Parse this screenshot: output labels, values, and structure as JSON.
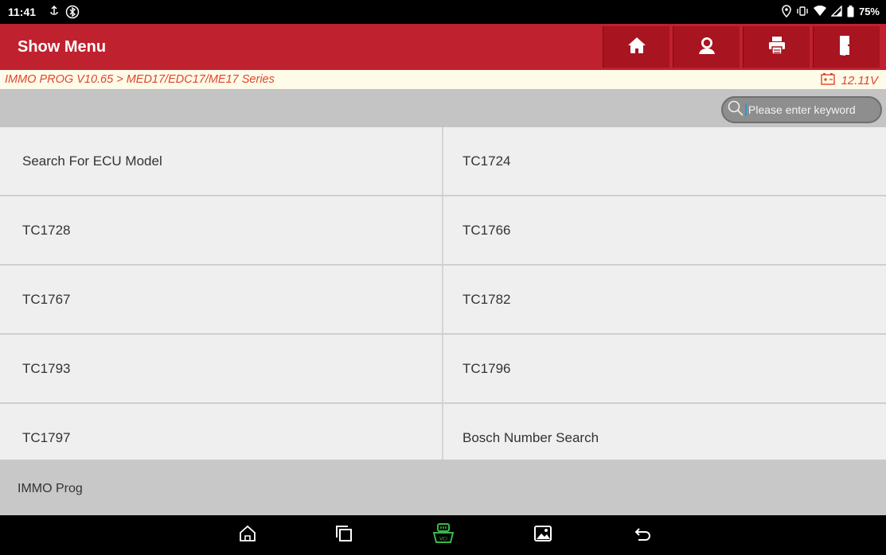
{
  "status": {
    "time": "11:41",
    "battery": "75%",
    "icons": [
      "usb-debug-icon",
      "bluetooth-status-icon",
      "location-icon",
      "vibrate-icon",
      "wifi-icon",
      "signal-icon",
      "battery-icon"
    ]
  },
  "header": {
    "title": "Show Menu",
    "buttons": [
      "home-icon",
      "account-icon",
      "printer-icon",
      "exit-icon"
    ]
  },
  "breadcrumb": {
    "path": "IMMO PROG V10.65 > MED17/EDC17/ME17 Series",
    "voltage": "12.11V"
  },
  "search": {
    "placeholder": "Please enter keyword"
  },
  "menu": {
    "items": [
      "Search For ECU Model",
      "TC1724",
      "TC1728",
      "TC1766",
      "TC1767",
      "TC1782",
      "TC1793",
      "TC1796",
      "TC1797",
      "Bosch Number Search"
    ]
  },
  "footer": {
    "label": "IMMO Prog"
  },
  "navbar": {
    "buttons": [
      "nav-home-icon",
      "recent-apps-icon",
      "vci-icon",
      "gallery-icon",
      "back-icon"
    ]
  },
  "colors": {
    "header_red": "#c0212e",
    "button_red": "#a8141f",
    "breadcrumb_text": "#e0442a",
    "vci_green": "#3cb64a"
  }
}
